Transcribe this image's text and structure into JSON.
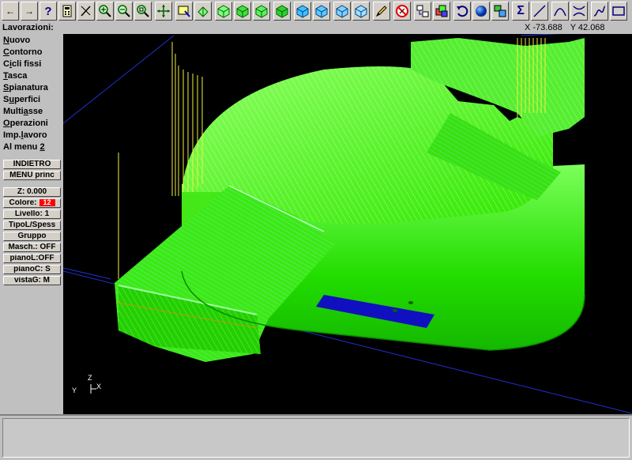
{
  "status": {
    "label": "Lavorazioni:",
    "x": "X -73.688",
    "y": "Y 42.068"
  },
  "toolbar": {
    "back": "←",
    "forward": "→",
    "help": "?"
  },
  "menu": [
    {
      "pre": "",
      "u": "N",
      "post": "uovo"
    },
    {
      "pre": "",
      "u": "C",
      "post": "ontorno"
    },
    {
      "pre": "C",
      "u": "i",
      "post": "cli fissi"
    },
    {
      "pre": "",
      "u": "T",
      "post": "asca"
    },
    {
      "pre": "",
      "u": "S",
      "post": "pianatura"
    },
    {
      "pre": "S",
      "u": "u",
      "post": "perfici"
    },
    {
      "pre": "Multi",
      "u": "a",
      "post": "sse"
    },
    {
      "pre": "",
      "u": "O",
      "post": "perazioni"
    },
    {
      "pre": "Imp.",
      "u": "l",
      "post": "avoro"
    },
    {
      "pre": "Al menu ",
      "u": "2",
      "post": ""
    }
  ],
  "buttons": {
    "indietro": "INDIETRO",
    "menu_princ": "MENU princ",
    "z": "Z:  0.000",
    "colore_label": "Colore:",
    "colore_value": "12",
    "livello": "Livello:  1",
    "tipo": "TipoL/Spess",
    "gruppo": "Gruppo",
    "masch": "Masch.: OFF",
    "pianoL": "pianoL:OFF",
    "pianoC": "pianoC:  S",
    "vistaG": "vistaG:  M"
  },
  "axes": {
    "z": "Z",
    "y": "Y",
    "x": "X"
  },
  "colors": {
    "color_12": "#ff0000",
    "model": "#22dd00",
    "background": "#000000"
  }
}
